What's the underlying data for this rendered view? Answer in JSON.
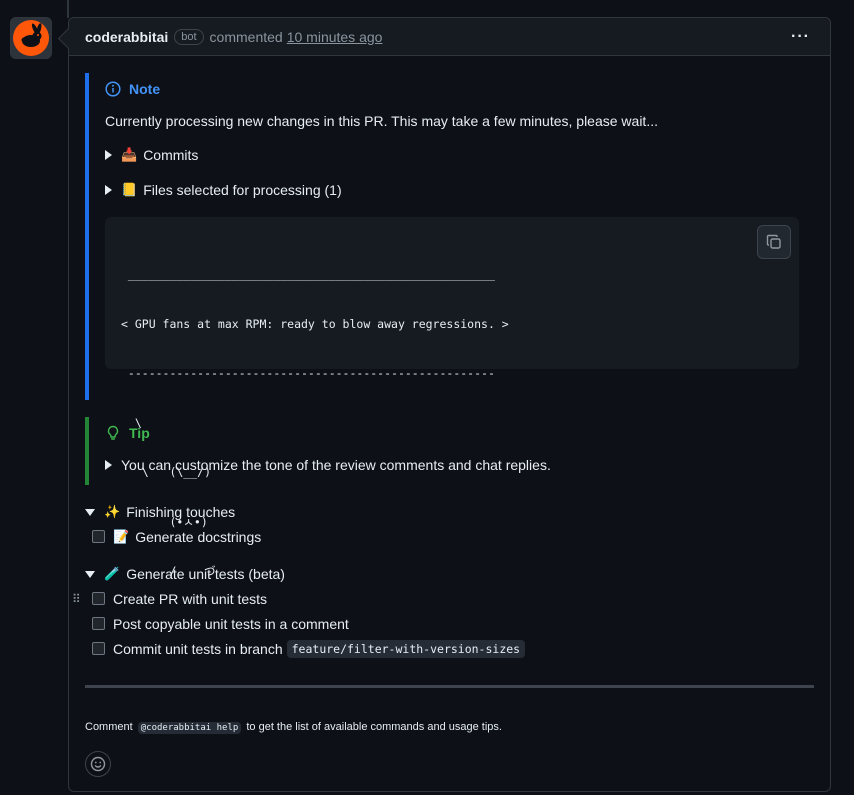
{
  "comment": {
    "author": "coderabbitai",
    "badge": "bot",
    "action": "commented",
    "time": "10 minutes ago",
    "menu_icon": "kebab-horizontal-icon"
  },
  "note": {
    "title": "Note",
    "text": "Currently processing new changes in this PR. This may take a few minutes, please wait...",
    "details": [
      {
        "emoji": "📥",
        "label": "Commits"
      },
      {
        "emoji": "📒",
        "label": "Files selected for processing (1)"
      }
    ],
    "code_lines": [
      " _____________________________________________________",
      "< GPU fans at max RPM: ready to blow away regressions. >",
      " -----------------------------------------------------",
      "  \\",
      "   \\   (\\__/)",
      "       (•ㅅ•)",
      "       /    づ"
    ]
  },
  "tip": {
    "title": "Tip",
    "details_label": "You can customize the tone of the review comments and chat replies."
  },
  "finishing": {
    "emoji": "✨",
    "label": "Finishing touches",
    "items": [
      {
        "emoji": "📝",
        "label": "Generate docstrings"
      }
    ]
  },
  "unit_tests": {
    "emoji": "🧪",
    "label": "Generate unit tests (beta)",
    "items": [
      {
        "label": "Create PR with unit tests"
      },
      {
        "label": "Post copyable unit tests in a comment"
      },
      {
        "label": "Commit unit tests in branch",
        "code": "feature/filter-with-version-sizes"
      }
    ]
  },
  "footer": {
    "prefix": "Comment",
    "code": "@coderabbitai help",
    "suffix": "to get the list of available commands and usage tips."
  },
  "colors": {
    "note_accent": "#4493f8",
    "tip_accent": "#3fb950",
    "avatar_bg": "#ff570a"
  }
}
